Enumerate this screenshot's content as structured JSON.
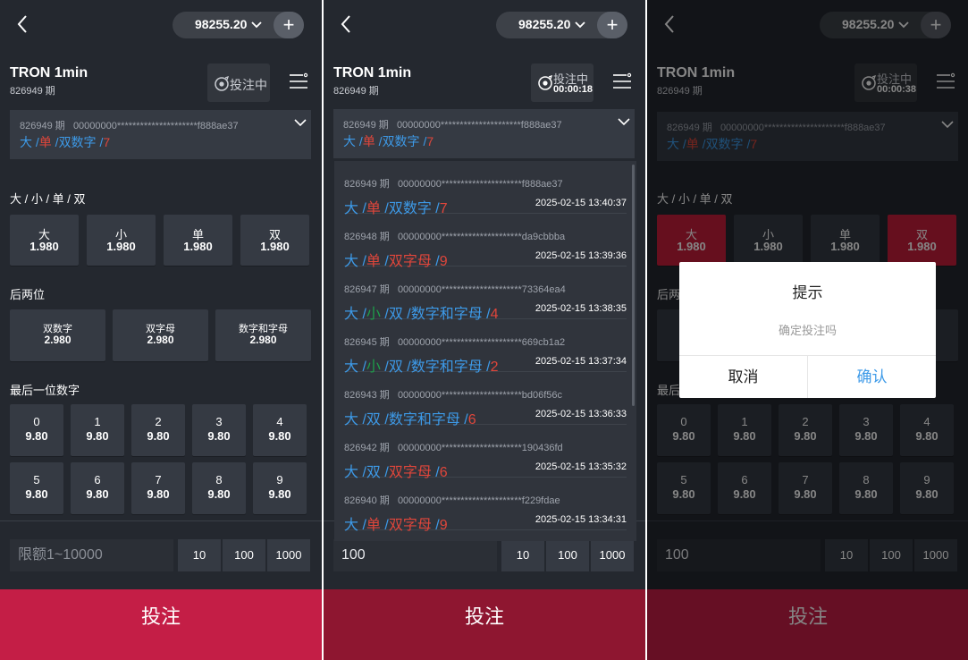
{
  "header": {
    "balance": "98255.20",
    "game_title": "TRON 1min",
    "period": "826949 期"
  },
  "status": {
    "label": "投注中",
    "timer_p2": "00:00:18",
    "timer_p3": "00:00:38"
  },
  "latest": {
    "period_label": "826949 期",
    "hash": "00000000*********************f888ae37",
    "result": {
      "size": "大",
      "sep1": " /",
      "parity": "单",
      "sep2": " /",
      "type": "双数字",
      "sep3": " /",
      "sum": "7"
    }
  },
  "sections": {
    "bsoe": "大 / 小 / 单 / 双",
    "last_two": "后两位",
    "last_digit": "最后一位数字"
  },
  "bsoe_options": [
    {
      "label": "大",
      "odds": "1.980"
    },
    {
      "label": "小",
      "odds": "1.980"
    },
    {
      "label": "单",
      "odds": "1.980"
    },
    {
      "label": "双",
      "odds": "1.980"
    }
  ],
  "last_two_options": [
    {
      "label": "双数字",
      "odds": "2.980"
    },
    {
      "label": "双字母",
      "odds": "2.980"
    },
    {
      "label": "数字和字母",
      "odds": "2.980"
    }
  ],
  "digit_options": [
    {
      "label": "0",
      "odds": "9.80"
    },
    {
      "label": "1",
      "odds": "9.80"
    },
    {
      "label": "2",
      "odds": "9.80"
    },
    {
      "label": "3",
      "odds": "9.80"
    },
    {
      "label": "4",
      "odds": "9.80"
    },
    {
      "label": "5",
      "odds": "9.80"
    },
    {
      "label": "6",
      "odds": "9.80"
    },
    {
      "label": "7",
      "odds": "9.80"
    },
    {
      "label": "8",
      "odds": "9.80"
    },
    {
      "label": "9",
      "odds": "9.80"
    }
  ],
  "amount": {
    "placeholder": "限额1~10000",
    "value": "100",
    "chips": [
      "10",
      "100",
      "1000"
    ]
  },
  "submit_label": "投注",
  "history": [
    {
      "period": "826949 期",
      "hash": "00000000*********************f888ae37",
      "time": "2025-02-15 13:40:37",
      "parts": [
        {
          "t": "大",
          "c": "blue"
        },
        {
          "t": " /",
          "c": "sep"
        },
        {
          "t": "单",
          "c": "red"
        },
        {
          "t": " /",
          "c": "sep"
        },
        {
          "t": "双数字",
          "c": "blue"
        },
        {
          "t": " /",
          "c": "sep"
        },
        {
          "t": "7",
          "c": "red"
        }
      ]
    },
    {
      "period": "826948 期",
      "hash": "00000000*********************da9cbbba",
      "time": "2025-02-15 13:39:36",
      "parts": [
        {
          "t": "大",
          "c": "blue"
        },
        {
          "t": " /",
          "c": "sep"
        },
        {
          "t": "单",
          "c": "red"
        },
        {
          "t": " /",
          "c": "sep"
        },
        {
          "t": "双字母",
          "c": "red"
        },
        {
          "t": " /",
          "c": "sep"
        },
        {
          "t": "9",
          "c": "red"
        }
      ]
    },
    {
      "period": "826947 期",
      "hash": "00000000*********************73364ea4",
      "time": "2025-02-15 13:38:35",
      "parts": [
        {
          "t": "大",
          "c": "blue"
        },
        {
          "t": " /",
          "c": "sep"
        },
        {
          "t": "小",
          "c": "green"
        },
        {
          "t": " /",
          "c": "sep"
        },
        {
          "t": "双",
          "c": "blue"
        },
        {
          "t": " /",
          "c": "sep"
        },
        {
          "t": "数字和字母",
          "c": "blue"
        },
        {
          "t": " /",
          "c": "sep"
        },
        {
          "t": "4",
          "c": "red"
        }
      ]
    },
    {
      "period": "826945 期",
      "hash": "00000000*********************669cb1a2",
      "time": "2025-02-15 13:37:34",
      "parts": [
        {
          "t": "大",
          "c": "blue"
        },
        {
          "t": " /",
          "c": "sep"
        },
        {
          "t": "小",
          "c": "green"
        },
        {
          "t": " /",
          "c": "sep"
        },
        {
          "t": "双",
          "c": "blue"
        },
        {
          "t": " /",
          "c": "sep"
        },
        {
          "t": "数字和字母",
          "c": "blue"
        },
        {
          "t": " /",
          "c": "sep"
        },
        {
          "t": "2",
          "c": "red"
        }
      ]
    },
    {
      "period": "826943 期",
      "hash": "00000000*********************bd06f56c",
      "time": "2025-02-15 13:36:33",
      "parts": [
        {
          "t": "大",
          "c": "blue"
        },
        {
          "t": " /",
          "c": "sep"
        },
        {
          "t": "双",
          "c": "blue"
        },
        {
          "t": " /",
          "c": "sep"
        },
        {
          "t": "数字和字母",
          "c": "blue"
        },
        {
          "t": " /",
          "c": "sep"
        },
        {
          "t": "6",
          "c": "red"
        }
      ]
    },
    {
      "period": "826942 期",
      "hash": "00000000*********************190436fd",
      "time": "2025-02-15 13:35:32",
      "parts": [
        {
          "t": "大",
          "c": "blue"
        },
        {
          "t": " /",
          "c": "sep"
        },
        {
          "t": "双",
          "c": "blue"
        },
        {
          "t": " /",
          "c": "sep"
        },
        {
          "t": "双字母",
          "c": "red"
        },
        {
          "t": " /",
          "c": "sep"
        },
        {
          "t": "6",
          "c": "red"
        }
      ]
    },
    {
      "period": "826940 期",
      "hash": "00000000*********************f229fdae",
      "time": "2025-02-15 13:34:31",
      "parts": [
        {
          "t": "大",
          "c": "blue"
        },
        {
          "t": " /",
          "c": "sep"
        },
        {
          "t": "单",
          "c": "red"
        },
        {
          "t": " /",
          "c": "sep"
        },
        {
          "t": "双字母",
          "c": "red"
        },
        {
          "t": " /",
          "c": "sep"
        },
        {
          "t": "9",
          "c": "red"
        }
      ]
    }
  ],
  "dialog": {
    "title": "提示",
    "message": "确定投注吗",
    "cancel": "取消",
    "confirm": "确认"
  },
  "colors": {
    "background": "#24282f",
    "card": "#353a43",
    "accent_red": "#c41e46",
    "selected_red": "#c41e3a",
    "result_blue": "#3d9ae8",
    "result_red": "#e0463b",
    "result_green": "#1e9e4a"
  },
  "icons": {
    "back": "chevron-left-icon",
    "dropdown": "chevron-down-icon",
    "add": "plus-icon",
    "status": "target-icon",
    "menu": "menu-lines-icon"
  }
}
